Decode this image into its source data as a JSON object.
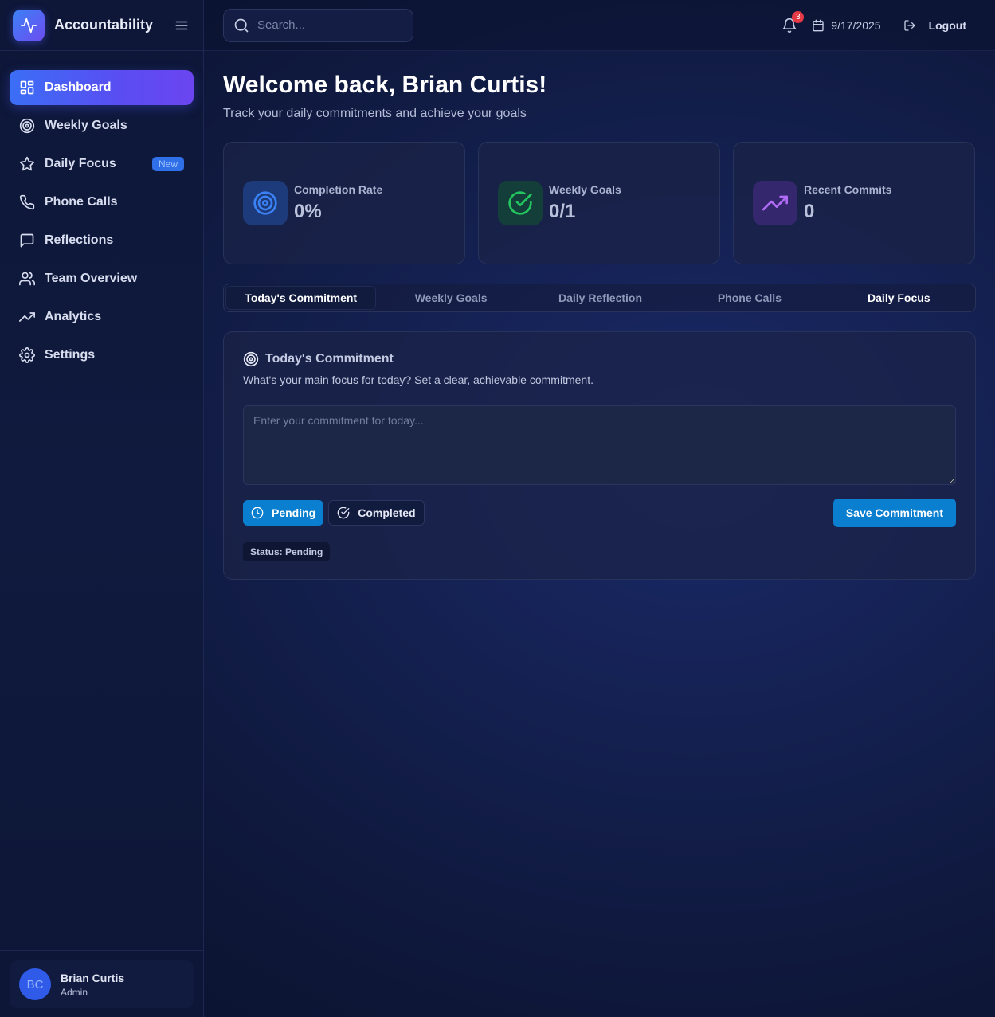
{
  "app": {
    "title": "Accountability"
  },
  "sidebar": {
    "items": [
      {
        "label": "Dashboard",
        "icon": "dashboard-icon",
        "active": true
      },
      {
        "label": "Weekly Goals",
        "icon": "target-icon"
      },
      {
        "label": "Daily Focus",
        "icon": "star-icon",
        "badge": "New"
      },
      {
        "label": "Phone Calls",
        "icon": "phone-icon"
      },
      {
        "label": "Reflections",
        "icon": "message-icon"
      },
      {
        "label": "Team Overview",
        "icon": "users-icon"
      },
      {
        "label": "Analytics",
        "icon": "trending-up-icon"
      },
      {
        "label": "Settings",
        "icon": "gear-icon"
      }
    ],
    "user": {
      "initials": "BC",
      "name": "Brian Curtis",
      "role": "Admin"
    }
  },
  "topbar": {
    "search_placeholder": "Search...",
    "notifications": "3",
    "date": "9/17/2025",
    "logout_label": "Logout"
  },
  "main": {
    "welcome": "Welcome back, Brian Curtis!",
    "subtitle": "Track your daily commitments and achieve your goals",
    "stats": [
      {
        "label": "Completion Rate",
        "value": "0%",
        "icon": "target-icon",
        "color": "#3b82f6"
      },
      {
        "label": "Weekly Goals",
        "value": "0/1",
        "icon": "check-circle-icon",
        "color": "#22c55e"
      },
      {
        "label": "Recent Commits",
        "value": "0",
        "icon": "trending-up-icon",
        "color": "#a855f7"
      }
    ],
    "tabs": [
      "Today's Commitment",
      "Weekly Goals",
      "Daily Reflection",
      "Phone Calls",
      "Daily Focus"
    ],
    "panel": {
      "title": "Today's Commitment",
      "description": "What's your main focus for today? Set a clear, achievable commitment.",
      "placeholder": "Enter your commitment for today...",
      "pending_label": "Pending",
      "completed_label": "Completed",
      "save_label": "Save Commitment",
      "status_text": "Status: Pending"
    }
  },
  "colors": {
    "accent": "#0a7fd0",
    "active_nav_start": "#3b6ef6",
    "active_nav_end": "#6a45f0",
    "danger": "#e53945"
  }
}
